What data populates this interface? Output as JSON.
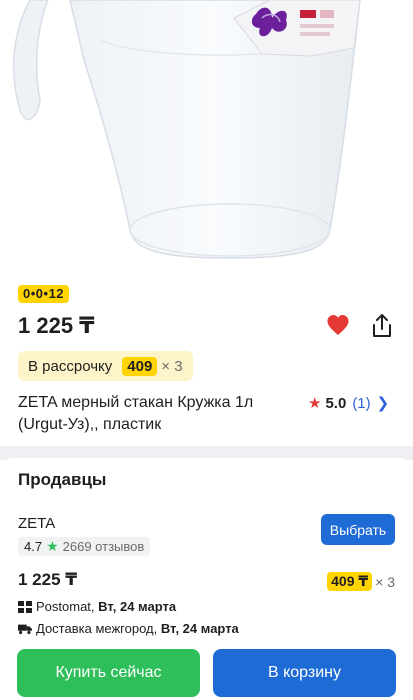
{
  "product": {
    "badge": "0•0•12",
    "price": "1 225 ₸",
    "installment": {
      "label": "В рассрочку",
      "monthly": "409",
      "multiplier": "× 3"
    },
    "title": "ZETA мерный стакан Кружка 1л (Urgut-Уз),, пластик",
    "rating": {
      "value": "5.0",
      "count": "(1)"
    }
  },
  "sellers": {
    "heading": "Продавцы",
    "seller": {
      "name": "ZETA",
      "rating": "4.7",
      "reviews": "2669 отзывов",
      "choose_label": "Выбрать",
      "price": "1 225 ₸",
      "installment_monthly": "409 ₸",
      "installment_multiplier": "× 3",
      "pickup_label": "Postomat,",
      "pickup_date": "Вт, 24 марта",
      "delivery_label": "Доставка межгород,",
      "delivery_date": "Вт, 24 марта"
    }
  },
  "actions": {
    "buy_now": "Купить сейчас",
    "add_to_cart": "В корзину"
  },
  "colors": {
    "accent_yellow": "#ffd400",
    "green": "#2fbf5a",
    "blue": "#1f6bd6",
    "heart_red": "#e53935"
  },
  "icons": {
    "favorite": "heart-icon",
    "share": "share-icon",
    "rating": "star-icon",
    "chevron": "chevron-right-icon",
    "pickup": "postomat-icon",
    "delivery": "truck-icon"
  }
}
